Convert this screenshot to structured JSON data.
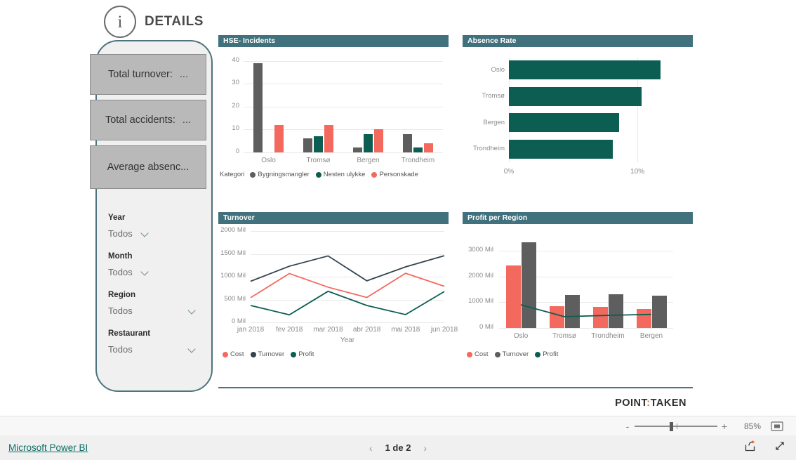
{
  "header": {
    "title": "DETAILS",
    "info_icon": "info-icon",
    "info_glyph": "i"
  },
  "side_panel": {
    "kpis": [
      {
        "label": "Total turnover:",
        "value": "..."
      },
      {
        "label": "Total accidents:",
        "value": "..."
      },
      {
        "label": "Average absenc...",
        "value": ""
      }
    ],
    "filters": [
      {
        "name": "Year",
        "value": "Todos"
      },
      {
        "name": "Month",
        "value": "Todos"
      },
      {
        "name": "Region",
        "value": "Todos"
      },
      {
        "name": "Restaurant",
        "value": "Todos"
      }
    ]
  },
  "brand": {
    "part1": "POINT",
    "sep": ":",
    "part2": "TAKEN"
  },
  "zoom_bar": {
    "minus": "-",
    "plus": "+",
    "percent": "85%",
    "fit_icon": "fit-to-page-icon"
  },
  "status_bar": {
    "link": "Microsoft Power BI",
    "prev_icon": "chevron-left-icon",
    "next_icon": "chevron-right-icon",
    "page_text": "1 de 2",
    "share_icon": "share-icon",
    "fullscreen_icon": "fullscreen-icon"
  },
  "colors": {
    "title_bar": "#40717c",
    "panel_border": "#4d737e",
    "gray": "#5e5e5e",
    "teal": "#0d5e52",
    "salmon": "#f4695e",
    "brand_accent": "#e8682b",
    "link": "#0b6e63"
  },
  "chart_data": [
    {
      "id": "hse_incidents",
      "type": "bar",
      "title": "HSE- Incidents",
      "xlabel": "",
      "ylabel": "",
      "ylim": [
        0,
        43
      ],
      "yticks": [
        "0",
        "10",
        "20",
        "30",
        "40"
      ],
      "ytick_values": [
        0,
        10,
        20,
        30,
        40
      ],
      "grid": true,
      "categories": [
        "Oslo",
        "Tromsø",
        "Bergen",
        "Trondheim"
      ],
      "legend_title": "Kategori",
      "legend_position": "bottom",
      "series": [
        {
          "name": "Bygningsmangler",
          "color": "#5e5e5e",
          "values": [
            39,
            6,
            2,
            8
          ]
        },
        {
          "name": "Nesten ulykke",
          "color": "#0d5e52",
          "values": [
            0,
            7,
            8,
            2
          ]
        },
        {
          "name": "Personskade",
          "color": "#f4695e",
          "values": [
            12,
            12,
            10,
            4
          ]
        }
      ]
    },
    {
      "id": "absence_rate",
      "type": "bar",
      "orientation": "horizontal",
      "title": "Absence Rate",
      "xlabel": "",
      "ylabel": "",
      "xlim": [
        0,
        13
      ],
      "xticks": [
        "0%",
        "10%"
      ],
      "xtick_values": [
        0,
        10
      ],
      "grid": true,
      "categories": [
        "Oslo",
        "Tromsø",
        "Bergen",
        "Trondheim"
      ],
      "values": [
        11.8,
        10.3,
        8.6,
        8.1
      ],
      "color": "#0d5e52"
    },
    {
      "id": "turnover",
      "type": "line",
      "title": "Turnover",
      "xlabel": "Year",
      "ylabel": "",
      "ylim": [
        0,
        2000
      ],
      "yticks": [
        "0 Mil",
        "500 Mil",
        "1000 Mil",
        "1500 Mil",
        "2000 Mil"
      ],
      "ytick_values": [
        0,
        500,
        1000,
        1500,
        2000
      ],
      "grid": true,
      "x": [
        "jan 2018",
        "fev 2018",
        "mar 2018",
        "abr 2018",
        "mai 2018",
        "jun 2018"
      ],
      "legend_position": "bottom",
      "series": [
        {
          "name": "Cost",
          "color": "#f4695e",
          "values": [
            540,
            1070,
            770,
            545,
            1075,
            790
          ]
        },
        {
          "name": "Turnover",
          "color": "#33444d",
          "values": [
            900,
            1230,
            1455,
            910,
            1215,
            1460
          ]
        },
        {
          "name": "Profit",
          "color": "#0d5e52",
          "values": [
            370,
            165,
            680,
            370,
            170,
            675
          ]
        }
      ]
    },
    {
      "id": "profit_per_region",
      "type": "bar",
      "title": "Profit per Region",
      "xlabel": "",
      "ylabel": "",
      "ylim": [
        0,
        3550
      ],
      "yticks": [
        "0 Mil",
        "1000 Mil",
        "2000 Mil",
        "3000 Mil"
      ],
      "ytick_values": [
        0,
        1000,
        2000,
        3000
      ],
      "grid": true,
      "categories": [
        "Oslo",
        "Tromsø",
        "Trondheim",
        "Bergen"
      ],
      "legend_position": "bottom",
      "series": [
        {
          "name": "Cost",
          "type": "bar",
          "color": "#f4695e",
          "values": [
            2420,
            850,
            810,
            740
          ]
        },
        {
          "name": "Turnover",
          "type": "bar",
          "color": "#5e5e5e",
          "values": [
            3320,
            1280,
            1320,
            1260
          ]
        },
        {
          "name": "Profit",
          "type": "line",
          "color": "#0d5e52",
          "values": [
            900,
            440,
            490,
            530
          ]
        }
      ]
    }
  ]
}
